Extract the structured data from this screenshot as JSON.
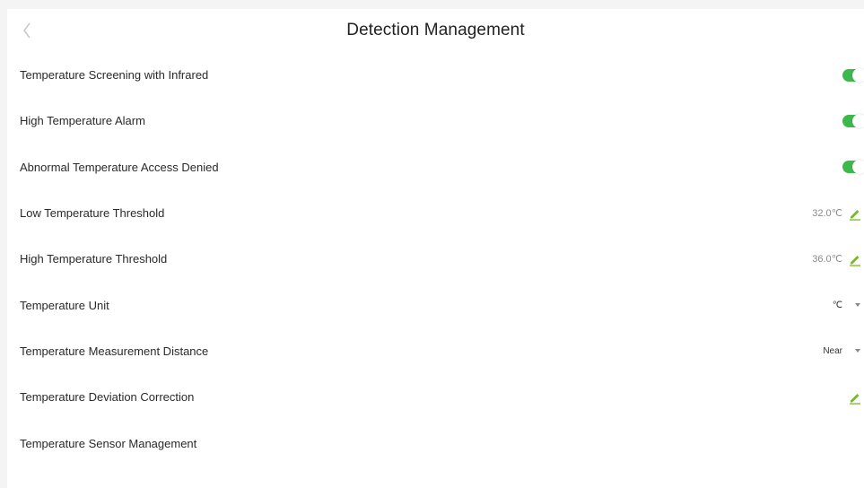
{
  "header": {
    "title": "Detection Management"
  },
  "settings": [
    {
      "label": "Temperature Screening with Infrared",
      "type": "toggle",
      "on": true
    },
    {
      "label": "High Temperature Alarm",
      "type": "toggle",
      "on": true
    },
    {
      "label": "Abnormal Temperature Access Denied",
      "type": "toggle",
      "on": true
    },
    {
      "label": "Low Temperature Threshold",
      "type": "edit",
      "value": "32.0℃"
    },
    {
      "label": "High Temperature Threshold",
      "type": "edit",
      "value": "36.0℃"
    },
    {
      "label": "Temperature Unit",
      "type": "select",
      "value": "℃"
    },
    {
      "label": "Temperature Measurement Distance",
      "type": "select",
      "value": "Near"
    },
    {
      "label": "Temperature Deviation Correction",
      "type": "edit",
      "value": ""
    },
    {
      "label": "Temperature Sensor Management",
      "type": "none"
    }
  ],
  "colors": {
    "toggle_on": "#3db84a",
    "pencil": "#7ab82a"
  },
  "icons": {
    "back": "chevron-left-icon",
    "edit": "pencil-icon",
    "dropdown": "caret-down-icon"
  }
}
